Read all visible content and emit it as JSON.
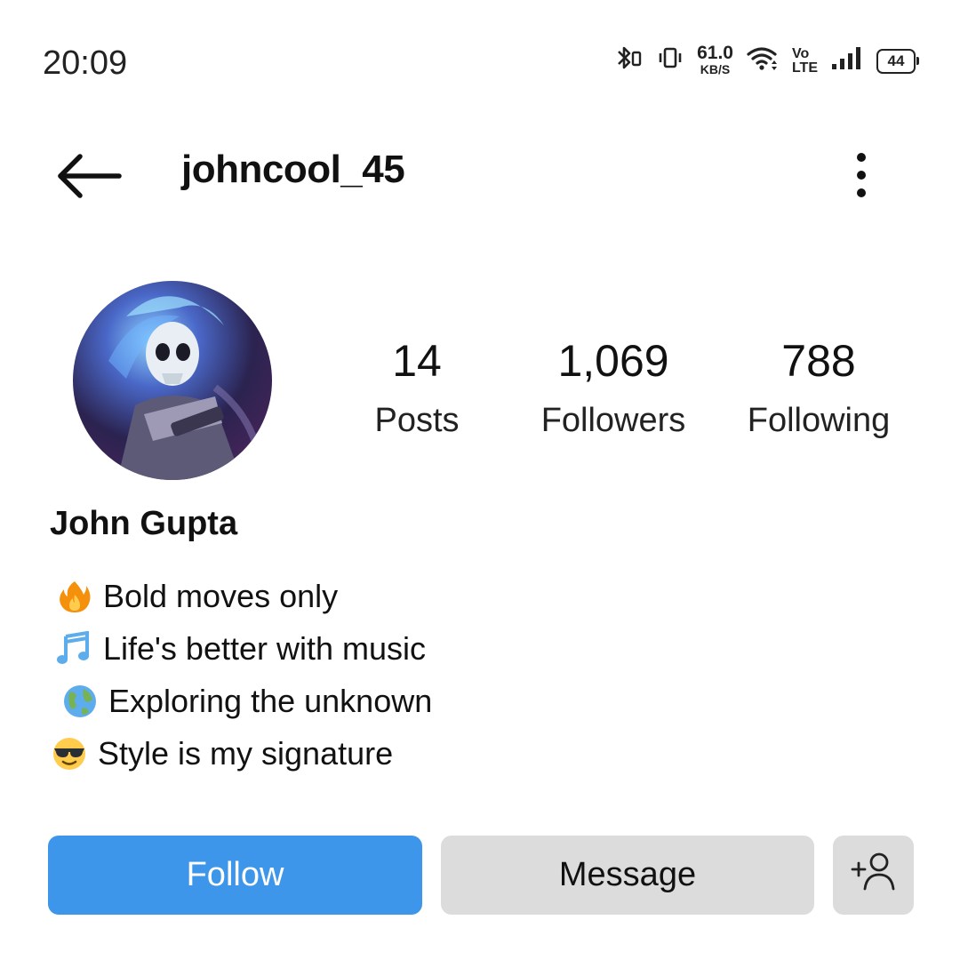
{
  "status_bar": {
    "time": "20:09",
    "net_speed_value": "61.0",
    "net_speed_unit": "KB/S",
    "volte_top": "Vo",
    "volte_bottom": "LTE",
    "battery": "44",
    "icons": [
      "bluetooth-icon",
      "vibrate-icon",
      "wifi-icon",
      "signal-icon",
      "battery-icon"
    ]
  },
  "header": {
    "username": "johncool_45",
    "back_icon": "back-arrow-icon",
    "menu_icon": "more-vertical-icon"
  },
  "profile": {
    "stats": [
      {
        "value": "14",
        "label": "Posts"
      },
      {
        "value": "1,069",
        "label": "Followers"
      },
      {
        "value": "788",
        "label": "Following"
      }
    ],
    "display_name": "John Gupta",
    "bio": [
      {
        "emoji": "fire-emoji",
        "text": "Bold moves only"
      },
      {
        "emoji": "music-notes-emoji",
        "text": "Life's better with music"
      },
      {
        "emoji": "globe-emoji",
        "text": "Exploring the unknown"
      },
      {
        "emoji": "sunglasses-face-emoji",
        "text": "Style is my signature"
      }
    ]
  },
  "actions": {
    "follow_label": "Follow",
    "message_label": "Message",
    "suggest_icon": "add-person-icon"
  },
  "colors": {
    "follow_button": "#3d96e9",
    "secondary_button": "#dcdcdc",
    "text": "#111111"
  }
}
